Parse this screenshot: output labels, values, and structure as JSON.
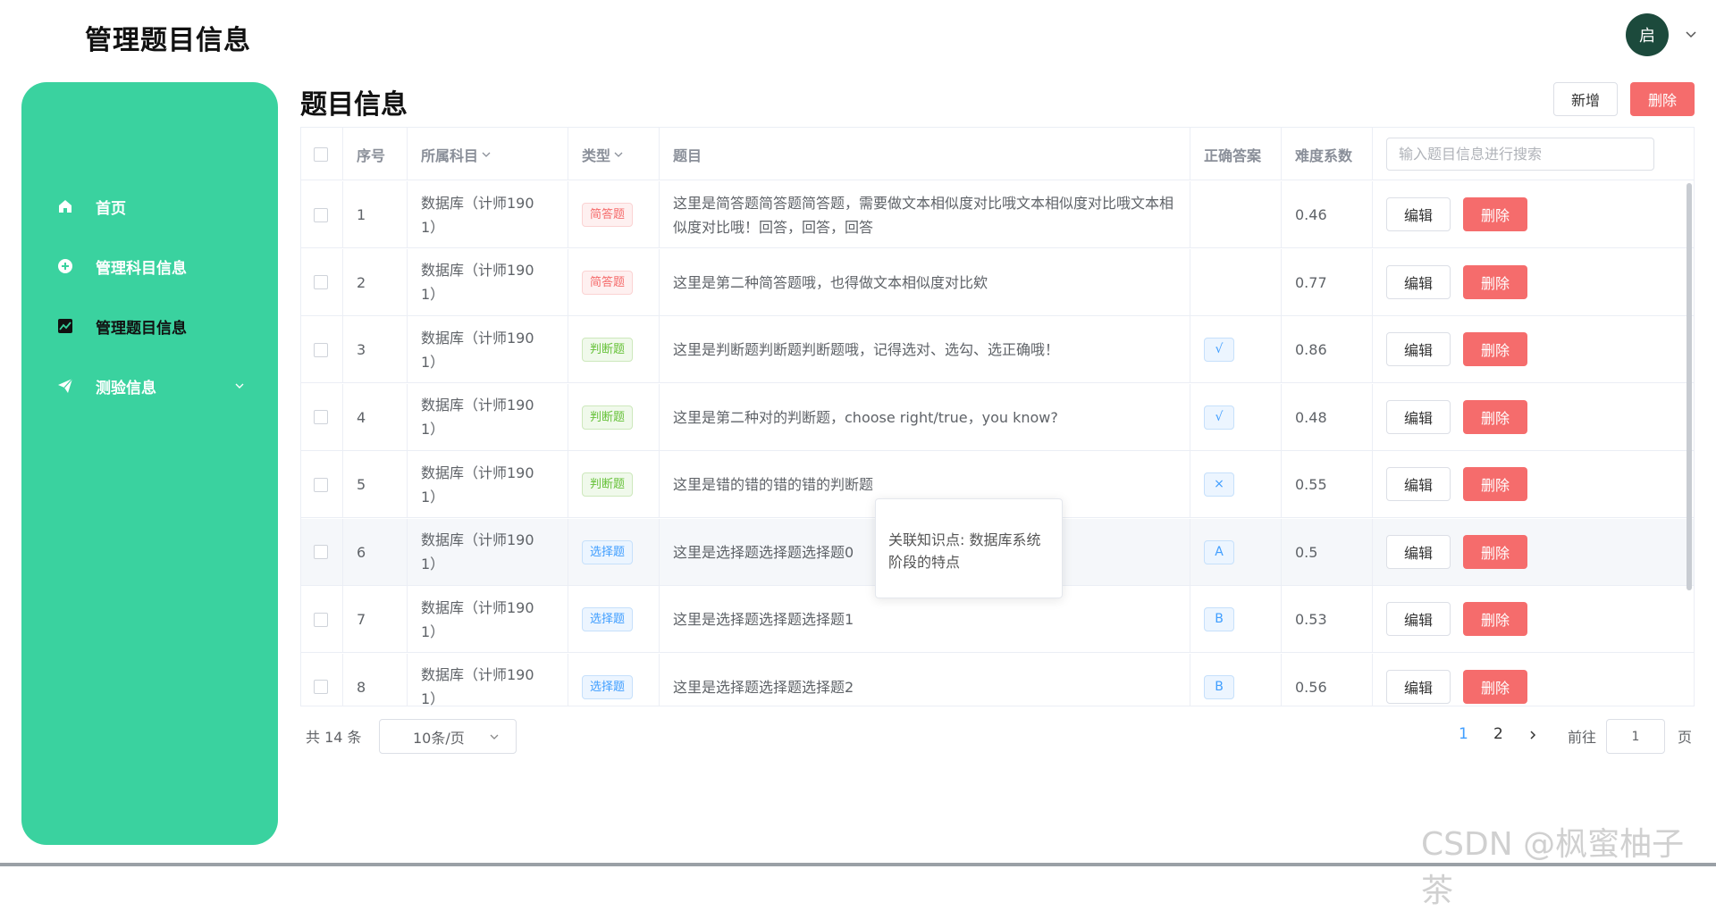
{
  "header": {
    "app_title": "管理题目信息",
    "avatar_text": "启"
  },
  "sidebar": {
    "items": [
      {
        "label": "首页",
        "icon": "home-icon"
      },
      {
        "label": "管理科目信息",
        "icon": "plus-circle-icon"
      },
      {
        "label": "管理题目信息",
        "icon": "chart-icon",
        "active": true
      },
      {
        "label": "测验信息",
        "icon": "paper-plane-icon",
        "expandable": true
      }
    ]
  },
  "main": {
    "title": "题目信息",
    "add_label": "新增",
    "delete_label": "删除"
  },
  "table": {
    "headers": {
      "no": "序号",
      "subject": "所属科目",
      "type": "类型",
      "question": "题目",
      "answer": "正确答案",
      "difficulty": "难度系数"
    },
    "search_placeholder": "输入题目信息进行搜索",
    "edit_label": "编辑",
    "delete_label": "删除",
    "rows": [
      {
        "no": "1",
        "subject": "数据库（计师190 1）",
        "type": "简答题",
        "type_kind": "short",
        "question": "这里是简答题简答题简答题，需要做文本相似度对比哦文本相似度对比哦文本相似度对比哦！回答，回答，回答",
        "answer": "",
        "difficulty": "0.46"
      },
      {
        "no": "2",
        "subject": "数据库（计师190 1）",
        "type": "简答题",
        "type_kind": "short",
        "question": "这里是第二种简答题哦，也得做文本相似度对比欸",
        "answer": "",
        "difficulty": "0.77"
      },
      {
        "no": "3",
        "subject": "数据库（计师190 1）",
        "type": "判断题",
        "type_kind": "judge",
        "question": "这里是判断题判断题判断题哦，记得选对、选勾、选正确哦！",
        "answer": "√",
        "difficulty": "0.86"
      },
      {
        "no": "4",
        "subject": "数据库（计师190 1）",
        "type": "判断题",
        "type_kind": "judge",
        "question": "这里是第二种对的判断题，choose right/true，you know?",
        "answer": "√",
        "difficulty": "0.48"
      },
      {
        "no": "5",
        "subject": "数据库（计师190 1）",
        "type": "判断题",
        "type_kind": "judge",
        "question": "这里是错的错的错的错的判断题",
        "answer": "×",
        "difficulty": "0.55"
      },
      {
        "no": "6",
        "subject": "数据库（计师190 1）",
        "type": "选择题",
        "type_kind": "choice",
        "question": "这里是选择题选择题选择题0",
        "answer": "A",
        "difficulty": "0.5"
      },
      {
        "no": "7",
        "subject": "数据库（计师190 1）",
        "type": "选择题",
        "type_kind": "choice",
        "question": "这里是选择题选择题选择题1",
        "answer": "B",
        "difficulty": "0.53"
      },
      {
        "no": "8",
        "subject": "数据库（计师190 1）",
        "type": "选择题",
        "type_kind": "choice",
        "question": "这里是选择题选择题选择题2",
        "answer": "B",
        "difficulty": "0.56"
      }
    ]
  },
  "tooltip": {
    "text": "关联知识点: 数据库系统阶段的特点"
  },
  "pagination": {
    "total": "共 14 条",
    "page_size": "10条/页",
    "pages": [
      "1",
      "2"
    ],
    "current_page": "1",
    "goto_label": "前往",
    "goto_value": "1",
    "goto_suffix": "页"
  },
  "watermark": "CSDN @枫蜜柚子茶",
  "colors": {
    "sidebar": "#3ad29f",
    "danger": "#f56c6c",
    "primary": "#409eff",
    "avatar": "#1c4a3c"
  }
}
